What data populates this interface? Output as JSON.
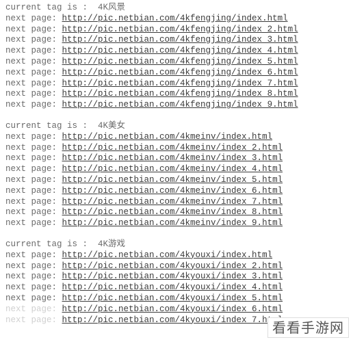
{
  "groups": [
    {
      "tag_line_prefix": "current tag is :  ",
      "tag_name": "4K风景",
      "line_prefix": "next page: ",
      "entries": [
        {
          "url": "http://pic.netbian.com/4kfengjing/index.html",
          "faded": false
        },
        {
          "url": "http://pic.netbian.com/4kfengjing/index_2.html",
          "faded": false
        },
        {
          "url": "http://pic.netbian.com/4kfengjing/index_3.html",
          "faded": false
        },
        {
          "url": "http://pic.netbian.com/4kfengjing/index_4.html",
          "faded": false
        },
        {
          "url": "http://pic.netbian.com/4kfengjing/index_5.html",
          "faded": false
        },
        {
          "url": "http://pic.netbian.com/4kfengjing/index_6.html",
          "faded": false
        },
        {
          "url": "http://pic.netbian.com/4kfengjing/index_7.html",
          "faded": false
        },
        {
          "url": "http://pic.netbian.com/4kfengjing/index_8.html",
          "faded": false
        },
        {
          "url": "http://pic.netbian.com/4kfengjing/index_9.html",
          "faded": false
        }
      ]
    },
    {
      "tag_line_prefix": "current tag is :  ",
      "tag_name": "4K美女",
      "line_prefix": "next page: ",
      "entries": [
        {
          "url": "http://pic.netbian.com/4kmeinv/index.html",
          "faded": false
        },
        {
          "url": "http://pic.netbian.com/4kmeinv/index_2.html",
          "faded": false
        },
        {
          "url": "http://pic.netbian.com/4kmeinv/index_3.html",
          "faded": false
        },
        {
          "url": "http://pic.netbian.com/4kmeinv/index_4.html",
          "faded": false
        },
        {
          "url": "http://pic.netbian.com/4kmeinv/index_5.html",
          "faded": false
        },
        {
          "url": "http://pic.netbian.com/4kmeinv/index_6.html",
          "faded": false
        },
        {
          "url": "http://pic.netbian.com/4kmeinv/index_7.html",
          "faded": false
        },
        {
          "url": "http://pic.netbian.com/4kmeinv/index_8.html",
          "faded": false
        },
        {
          "url": "http://pic.netbian.com/4kmeinv/index_9.html",
          "faded": false
        }
      ]
    },
    {
      "tag_line_prefix": "current tag is :  ",
      "tag_name": "4K游戏",
      "line_prefix": "next page: ",
      "entries": [
        {
          "url": "http://pic.netbian.com/4kyouxi/index.html",
          "faded": false
        },
        {
          "url": "http://pic.netbian.com/4kyouxi/index_2.html",
          "faded": false
        },
        {
          "url": "http://pic.netbian.com/4kyouxi/index_3.html",
          "faded": false
        },
        {
          "url": "http://pic.netbian.com/4kyouxi/index_4.html",
          "faded": false
        },
        {
          "url": "http://pic.netbian.com/4kyouxi/index_5.html",
          "faded": false
        },
        {
          "url": "http://pic.netbian.com/4kyouxi/index_6.html",
          "faded": true
        },
        {
          "url": "http://pic.netbian.com/4kyouxi/index_7.html",
          "faded": true
        }
      ]
    }
  ],
  "watermark": "看看手游网"
}
